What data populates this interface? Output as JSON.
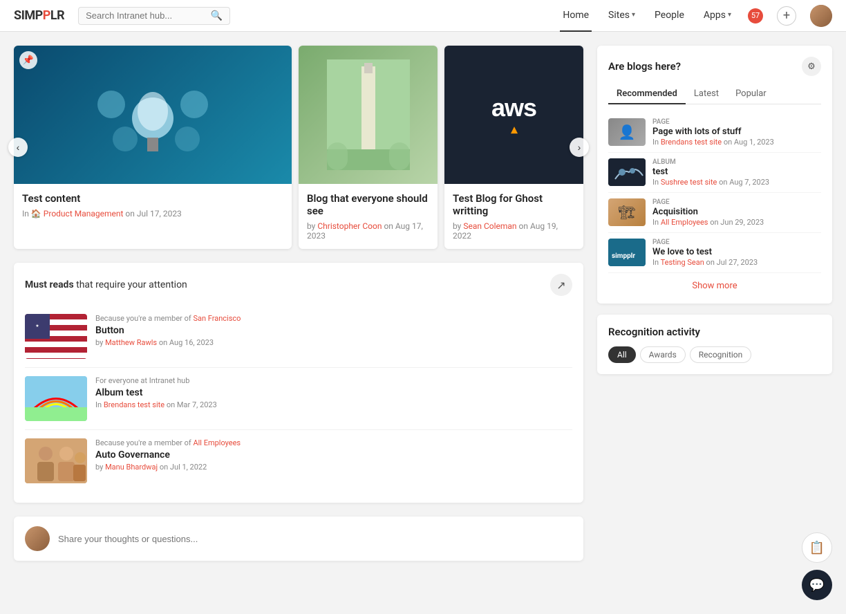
{
  "header": {
    "logo": "SIMPPLR",
    "search_placeholder": "Search Intranet hub...",
    "nav": {
      "home": "Home",
      "sites": "Sites",
      "people": "People",
      "apps": "Apps"
    },
    "notification_count": "57"
  },
  "carousel": {
    "prev_label": "‹",
    "next_label": "›",
    "cards": [
      {
        "title": "Test content",
        "in_label": "In",
        "category": "Product Management",
        "date": "on Jul 17, 2023",
        "type": "large"
      },
      {
        "title": "Blog that everyone should see",
        "by_label": "by",
        "author": "Christopher Coon",
        "date": "on Aug 17, 2023",
        "type": "medium"
      },
      {
        "title": "Test Blog for Ghost writting",
        "by_label": "by",
        "author": "Sean Coleman",
        "date": "on Aug 19, 2022",
        "type": "medium"
      }
    ]
  },
  "must_reads": {
    "title_bold": "Must reads",
    "title_rest": "that require your attention",
    "items": [
      {
        "reason_prefix": "Because you're a member of",
        "reason_link": "San Francisco",
        "title": "Button",
        "by": "by",
        "author": "Matthew Rawls",
        "date": "on Aug 16, 2023"
      },
      {
        "reason_prefix": "For everyone at Intranet hub",
        "reason_link": "",
        "title": "Album test",
        "location_label": "In",
        "location": "Brendans test site",
        "date": "on Mar 7, 2023"
      },
      {
        "reason_prefix": "Because you're a member of",
        "reason_link": "All Employees",
        "title": "Auto Governance",
        "by": "by",
        "author": "Manu Bhardwaj",
        "date": "on Jul 1, 2022"
      }
    ]
  },
  "share_thoughts": {
    "placeholder": "Share your thoughts or questions..."
  },
  "blog_section": {
    "title": "Are blogs here?",
    "tabs": [
      "Recommended",
      "Latest",
      "Popular"
    ],
    "active_tab": "Recommended",
    "items": [
      {
        "type": "PAGE",
        "name": "Page with lots of stuff",
        "source_prefix": "In",
        "source": "Brendans test site",
        "date": "on Aug 1, 2023"
      },
      {
        "type": "ALBUM",
        "name": "test",
        "source_prefix": "In",
        "source": "Sushree test site",
        "date": "on Aug 7, 2023"
      },
      {
        "type": "PAGE",
        "name": "Acquisition",
        "source_prefix": "In",
        "source": "All Employees",
        "date": "on Jun 29, 2023"
      },
      {
        "type": "PAGE",
        "name": "We love to test",
        "source_prefix": "In",
        "source": "Testing Sean",
        "date": "on Jul 27, 2023"
      }
    ],
    "show_more": "Show more"
  },
  "recognition": {
    "title": "Recognition activity",
    "tabs": [
      "All",
      "Awards",
      "Recognition"
    ],
    "active_tab": "All"
  },
  "bottom_buttons": {
    "notes_icon": "📋",
    "chat_icon": "💬"
  }
}
